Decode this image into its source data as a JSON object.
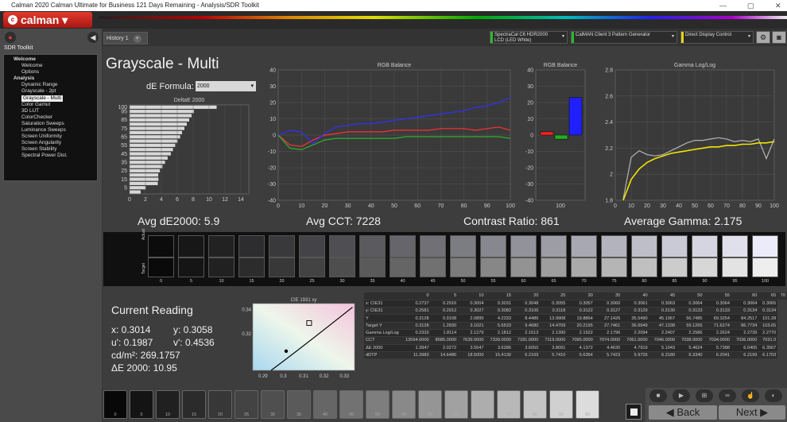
{
  "window": {
    "title": "Calman 2020 Calman Ultimate for Business 121 Days Remaining - Analysis/SDR Toolkit"
  },
  "brand": {
    "logo_text": "calman"
  },
  "left": {
    "section": "SDR Toolkit",
    "tree": [
      {
        "label": "Welcome",
        "level": "grp"
      },
      {
        "label": "Welcome",
        "level": "sub"
      },
      {
        "label": "Options",
        "level": "sub"
      },
      {
        "label": "Analysis",
        "level": "grp"
      },
      {
        "label": "Dynamic Range",
        "level": "sub"
      },
      {
        "label": "Grayscale - 2pt",
        "level": "sub"
      },
      {
        "label": "Grayscale - Multi",
        "level": "sub",
        "selected": true
      },
      {
        "label": "Color Gamut",
        "level": "sub"
      },
      {
        "label": "3D LUT",
        "level": "sub"
      },
      {
        "label": "ColorChecker",
        "level": "sub"
      },
      {
        "label": "Saturation Sweeps",
        "level": "sub"
      },
      {
        "label": "Luminance Sweeps",
        "level": "sub"
      },
      {
        "label": "Screen Uniformity",
        "level": "sub"
      },
      {
        "label": "Screen Angularity",
        "level": "sub"
      },
      {
        "label": "Screen Stability",
        "level": "sub"
      },
      {
        "label": "Spectral Power Dist.",
        "level": "sub"
      }
    ]
  },
  "tabs": {
    "history": "History 1"
  },
  "devices": [
    {
      "line1": "SpectraCal C6 HDR2000",
      "line2": "LCD (LED White)",
      "color": "#2eb82e"
    },
    {
      "line1": "CalMAN Client 3 Pattern Generator",
      "line2": "",
      "color": "#2eb82e"
    },
    {
      "line1": "Direct Display Control",
      "line2": "",
      "color": "#e8d21c"
    }
  ],
  "page": {
    "title": "Grayscale - Multi",
    "de_formula_label": "dE Formula:",
    "de_formula_value": "2000"
  },
  "stats": {
    "avg_de": "Avg dE2000: 5.9",
    "avg_cct": "Avg CCT: 7228",
    "contrast": "Contrast Ratio: 861",
    "avg_gamma": "Average Gamma: 2.175"
  },
  "swatch_labels": {
    "actual": "Actual",
    "target": "Target"
  },
  "current": {
    "heading": "Current Reading",
    "x": "x: 0.3014",
    "y": "y: 0.3058",
    "u": "u': 0.1987",
    "v": "v': 0.4536",
    "cdm": "cd/m²: 269.1757",
    "de": "ΔE 2000: 10.95"
  },
  "table": {
    "columns": [
      "0",
      "5",
      "10",
      "15",
      "20",
      "25",
      "30",
      "35",
      "40",
      "45",
      "50",
      "55",
      "60",
      "65",
      "70"
    ],
    "rows": [
      {
        "label": "x: CIE31",
        "values": [
          "0.2737",
          "0.2916",
          "0.3004",
          "0.3031",
          "0.3048",
          "0.3055",
          "0.3057",
          "0.3060",
          "0.3061",
          "0.3063",
          "0.3064",
          "0.3064",
          "0.3064",
          "0.3065"
        ]
      },
      {
        "label": "y: CIE31",
        "values": [
          "0.2581",
          "0.2912",
          "0.3027",
          "0.3082",
          "0.3106",
          "0.3118",
          "0.3122",
          "0.3127",
          "0.3129",
          "0.3130",
          "0.3133",
          "0.3133",
          "0.3134",
          "0.3134"
        ]
      },
      {
        "label": "Y",
        "values": [
          "0.3128",
          "0.9108",
          "2.0895",
          "4.2333",
          "8.4486",
          "13.9908",
          "19.8864",
          "27.1426",
          "35.5490",
          "45.1967",
          "56.7485",
          "69.3254",
          "84.2517",
          "101.28"
        ]
      },
      {
        "label": "Target Y",
        "values": [
          "0.3128",
          "1.2830",
          "3.1021",
          "5.6533",
          "9.4680",
          "14.4709",
          "20.2195",
          "27.7461",
          "36.6949",
          "47.1338",
          "59.1265",
          "71.6274",
          "86.7734",
          "103.65"
        ]
      },
      {
        "label": "Gamma Log/Log",
        "values": [
          "0.2333",
          "1.8114",
          "2.1279",
          "2.1812",
          "2.1513",
          "2.1390",
          "2.1522",
          "2.1796",
          "2.2094",
          "2.2407",
          "2.2586",
          "2.2624",
          "2.2739",
          "2.2770"
        ]
      },
      {
        "label": "CCT",
        "values": [
          "13594.0000",
          "8685.0000",
          "7639.0000",
          "7339.0000",
          "7181.0000",
          "7119.0000",
          "7095.0000",
          "7074.0000",
          "7061.0000",
          "7046.0000",
          "7038.0000",
          "7034.0000",
          "7036.0000",
          "7031.0"
        ]
      },
      {
        "label": "ΔE 2000",
        "values": [
          "1.3947",
          "2.0272",
          "3.5547",
          "3.6286",
          "3.6050",
          "3.8091",
          "4.1372",
          "4.4630",
          "4.7919",
          "5.1943",
          "5.4624",
          "5.7388",
          "6.0405",
          "6.3567"
        ]
      },
      {
        "label": "dDTP",
        "values": [
          "11.3983",
          "14.6480",
          "18.5000",
          "15.4130",
          "6.2169",
          "5.7410",
          "5.6354",
          "5.7423",
          "5.9726",
          "6.3180",
          "6.3340",
          "6.2041",
          "6.2199",
          "6.1703"
        ]
      }
    ]
  },
  "bottom_labels": [
    "0",
    "5",
    "10",
    "15",
    "20",
    "25",
    "30",
    "35",
    "40",
    "45",
    "50",
    "55",
    "60",
    "65",
    "70",
    "75",
    "80",
    "85",
    "90"
  ],
  "nav": {
    "back": "Back",
    "next": "Next"
  },
  "chart_data": [
    {
      "type": "bar",
      "title": "DeltaE 2000",
      "orientation": "horizontal",
      "categories": [
        "0",
        "5",
        "10",
        "15",
        "20",
        "25",
        "30",
        "35",
        "40",
        "45",
        "50",
        "55",
        "60",
        "65",
        "70",
        "75",
        "80",
        "85",
        "90",
        "95",
        "100"
      ],
      "values": [
        1.39,
        2.03,
        3.55,
        3.63,
        3.61,
        3.81,
        4.14,
        4.46,
        4.79,
        5.19,
        5.46,
        5.74,
        6.04,
        6.36,
        6.6,
        6.9,
        7.2,
        7.5,
        7.8,
        8.1,
        10.95
      ],
      "xticks": [
        "0",
        "2",
        "4",
        "6",
        "8",
        "10",
        "12",
        "14"
      ],
      "xlim": [
        0,
        15
      ],
      "ylabel_ticks": [
        "5",
        "15",
        "25",
        "35",
        "45",
        "55",
        "65",
        "75",
        "85",
        "95",
        "100"
      ]
    },
    {
      "type": "line",
      "title": "RGB Balance",
      "x": [
        0,
        5,
        10,
        15,
        20,
        25,
        30,
        35,
        40,
        45,
        50,
        55,
        60,
        65,
        70,
        75,
        80,
        85,
        90,
        95,
        100
      ],
      "ylim": [
        -40,
        40
      ],
      "yticks": [
        "40",
        "30",
        "20",
        "10",
        "0",
        "-10",
        "-20",
        "-30",
        "-40"
      ],
      "xticks": [
        "0",
        "10",
        "20",
        "30",
        "40",
        "50",
        "60",
        "70",
        "80",
        "90",
        "100"
      ],
      "series": [
        {
          "color": "#ff3030",
          "values": [
            0,
            -6,
            -7,
            -3,
            0,
            1,
            2,
            2,
            2,
            2,
            3,
            3,
            3,
            3,
            4,
            4,
            4,
            3,
            4,
            5,
            3
          ]
        },
        {
          "color": "#30b030",
          "values": [
            0,
            -8,
            -9,
            -6,
            -3,
            -2,
            -2,
            -2,
            -2,
            -2,
            -2,
            -1,
            -1,
            -1,
            -1,
            -1,
            -1,
            -1,
            -1,
            -1,
            -2
          ]
        },
        {
          "color": "#3030ff",
          "values": [
            0,
            3,
            2,
            -5,
            1,
            5,
            6,
            7,
            7,
            8,
            9,
            10,
            11,
            12,
            13,
            14,
            15,
            17,
            18,
            20,
            23
          ]
        }
      ]
    },
    {
      "type": "bar",
      "title": "RGB Balance",
      "categories": [
        "R",
        "G",
        "B"
      ],
      "values": [
        2,
        -2.5,
        23
      ],
      "colors": [
        "#ff2020",
        "#20b020",
        "#2020ff"
      ],
      "ylim": [
        -40,
        40
      ],
      "yticks": [
        "40",
        "30",
        "20",
        "10",
        "0",
        "-10",
        "-20",
        "-30",
        "-40"
      ],
      "xtick": "100"
    },
    {
      "type": "line",
      "title": "Gamma Log/Log",
      "x": [
        0,
        5,
        10,
        15,
        20,
        25,
        30,
        35,
        40,
        45,
        50,
        55,
        60,
        65,
        70,
        75,
        80,
        85,
        90,
        95,
        100
      ],
      "ylim": [
        1.8,
        2.8
      ],
      "yticks": [
        "2.8",
        "2.6",
        "2.4",
        "2.2",
        "2",
        "1.8"
      ],
      "xticks": [
        "0",
        "10",
        "20",
        "30",
        "40",
        "50",
        "60",
        "70",
        "80",
        "90",
        "100"
      ],
      "series": [
        {
          "color": "#b5b5b5",
          "values": [
            null,
            1.81,
            2.13,
            2.18,
            2.15,
            2.14,
            2.15,
            2.18,
            2.21,
            2.24,
            2.26,
            2.26,
            2.27,
            2.28,
            2.27,
            2.25,
            2.26,
            2.25,
            2.27,
            2.12,
            2.27
          ]
        },
        {
          "color": "#f0e400",
          "values": [
            null,
            1.8,
            1.96,
            2.04,
            2.09,
            2.12,
            2.14,
            2.16,
            2.17,
            2.18,
            2.19,
            2.2,
            2.21,
            2.21,
            2.22,
            2.22,
            2.23,
            2.23,
            2.24,
            2.24,
            2.25
          ]
        }
      ]
    },
    {
      "type": "scatter",
      "title": "CIE 1931 xy",
      "xticks": [
        "0.29",
        "0.3",
        "0.31",
        "0.32",
        "0.33"
      ],
      "yticks": [
        "0.34",
        "0.32"
      ],
      "xlim": [
        0.285,
        0.335
      ],
      "ylim": [
        0.29,
        0.345
      ],
      "points": [
        {
          "x": 0.3014,
          "y": 0.3058
        },
        {
          "x": 0.3127,
          "y": 0.329
        }
      ]
    }
  ]
}
